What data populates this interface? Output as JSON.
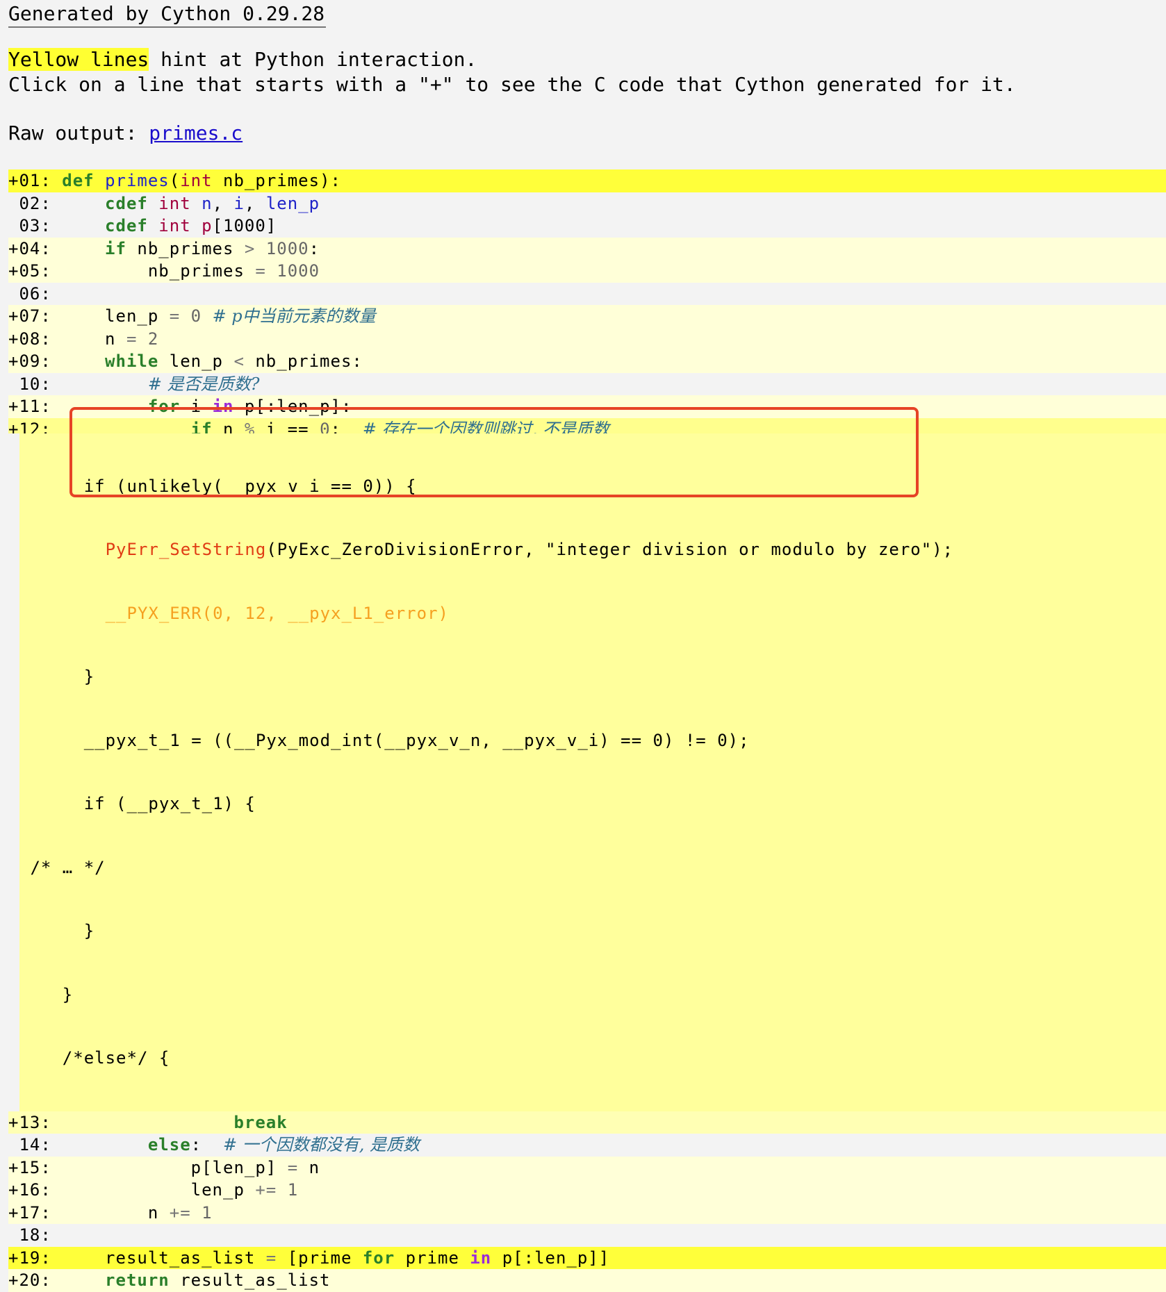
{
  "header": {
    "generated": "Generated by Cython 0.29.28",
    "hint_highlight": "Yellow lines",
    "hint_rest": " hint at Python interaction.",
    "click_text": "Click on a line that starts with a \"+\" to see the C code that Cython generated for it.",
    "raw_label": "Raw output: ",
    "raw_link": "primes.c"
  },
  "lines": {
    "l01": {
      "no": "+01: ",
      "kw": "def",
      "fn": "primes",
      "rest1": "(",
      "typ": "int",
      "rest2": " nb_primes):"
    },
    "l02": {
      "no": " 02: ",
      "indent": "    ",
      "kw": "cdef",
      "typ": "int",
      "v1": "n",
      "sep1": ", ",
      "v2": "i",
      "sep2": ", ",
      "v3": "len_p"
    },
    "l03": {
      "no": " 03: ",
      "indent": "    ",
      "kw": "cdef",
      "typ": "int",
      "v1": "p",
      "rest": "[1000]"
    },
    "l04": {
      "no": "+04: ",
      "indent": "    ",
      "kw": "if",
      "a": " nb_primes ",
      "op": ">",
      "num": " 1000",
      "end": ":"
    },
    "l05": {
      "no": "+05: ",
      "indent": "        ",
      "a": "nb_primes ",
      "op": "=",
      "num": " 1000"
    },
    "l06": {
      "no": " 06:"
    },
    "l07": {
      "no": "+07: ",
      "indent": "    ",
      "a": "len_p ",
      "op": "=",
      "num": " 0 ",
      "com": "# p中当前元素的数量"
    },
    "l08": {
      "no": "+08: ",
      "indent": "    ",
      "a": "n ",
      "op": "=",
      "num": " 2"
    },
    "l09": {
      "no": "+09: ",
      "indent": "    ",
      "kw": "while",
      "a": " len_p ",
      "op": "<",
      "b": " nb_primes:"
    },
    "l10": {
      "no": " 10: ",
      "indent": "        ",
      "com": "# 是否是质数?"
    },
    "l11": {
      "no": "+11: ",
      "indent": "        ",
      "kw": "for",
      "a": " i ",
      "kin": "in",
      "b": " p[:len_p]:"
    },
    "l12": {
      "no": "+12: ",
      "indent": "            ",
      "kw": "if",
      "a": " n ",
      "op": "%",
      "b": " i ",
      "op2": "==",
      "num": " 0",
      "c": ":  ",
      "com": "# 存在一个因数则跳过, 不是质数"
    },
    "l13": {
      "no": "+13: ",
      "indent": "                ",
      "kw": "break"
    },
    "l14": {
      "no": " 14: ",
      "indent": "        ",
      "kw": "else",
      "a": ":  ",
      "com": "# 一个因数都没有, 是质数"
    },
    "l15": {
      "no": "+15: ",
      "indent": "            ",
      "a": "p[len_p] ",
      "op": "=",
      "b": " n"
    },
    "l16": {
      "no": "+16: ",
      "indent": "            ",
      "a": "len_p ",
      "op": "+=",
      "num": " 1"
    },
    "l17": {
      "no": "+17: ",
      "indent": "        ",
      "a": "n ",
      "op": "+=",
      "num": " 1"
    },
    "l18": {
      "no": " 18:"
    },
    "l19": {
      "no": "+19: ",
      "indent": "    ",
      "a": "result_as_list ",
      "op": "=",
      "b": " [prime ",
      "kw": "for",
      "c": " prime ",
      "kin": "in",
      "d": " p[:len_p]]"
    },
    "l20": {
      "no": "+20: ",
      "indent": "    ",
      "kw": "return",
      "a": " result_as_list"
    }
  },
  "ccode": {
    "c1": "      if (unlikely(__pyx_v_i == 0)) {",
    "c2_pre": "        ",
    "c2_err": "PyErr_SetString",
    "c2_rest": "(PyExc_ZeroDivisionError, \"integer division or modulo by zero\");",
    "c3_pre": "        ",
    "c3_err": "__PYX_ERR(0, 12, __pyx_L1_error)",
    "c4": "      }",
    "c5": "      __pyx_t_1 = ((__Pyx_mod_int(__pyx_v_n, __pyx_v_i) == 0) != 0);",
    "c6": "      if (__pyx_t_1) {",
    "c7": " /* … */",
    "c8": "      }",
    "c9": "    }",
    "c10": "    /*else*/ {"
  },
  "colors": {
    "highlight_strong": "#ffff3a",
    "highlight_light": "#ffffd8",
    "annotation_border": "#e64326"
  }
}
